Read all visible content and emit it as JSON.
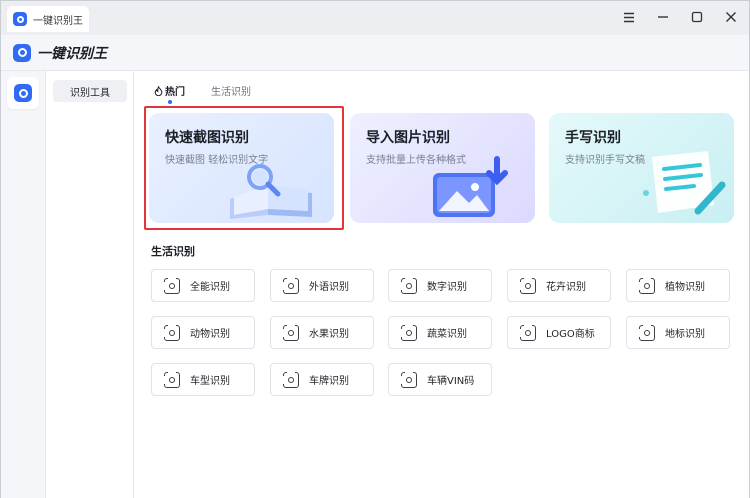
{
  "window": {
    "tab_title": "一键识别王",
    "buttons": [
      "menu-icon",
      "minimize-icon",
      "maximize-icon",
      "close-icon"
    ]
  },
  "header": {
    "app_name": "一键识别王"
  },
  "sidebar": {
    "items": [
      {
        "label": "识别工具",
        "active": true
      }
    ]
  },
  "main": {
    "tabs": [
      {
        "label": "热门",
        "icon": "flame-icon",
        "active": true
      },
      {
        "label": "生活识别",
        "active": false
      }
    ],
    "features": [
      {
        "title": "快速截图识别",
        "subtitle": "快速截图 轻松识别文字",
        "icon": "book-search-illustration",
        "selected": true
      },
      {
        "title": "导入图片识别",
        "subtitle": "支持批量上传各种格式",
        "icon": "image-import-illustration"
      },
      {
        "title": "手写识别",
        "subtitle": "支持识别手写文稿",
        "icon": "paper-pen-illustration"
      }
    ],
    "section_title": "生活识别",
    "tools": [
      {
        "label": "全能识别",
        "icon": "eye-scan-icon"
      },
      {
        "label": "外语识别",
        "icon": "abc-scan-icon"
      },
      {
        "label": "数字识别",
        "icon": "123-scan-icon"
      },
      {
        "label": "花卉识别",
        "icon": "flower-scan-icon"
      },
      {
        "label": "植物识别",
        "icon": "plant-scan-icon"
      },
      {
        "label": "动物识别",
        "icon": "animal-scan-icon"
      },
      {
        "label": "水果识别",
        "icon": "fruit-scan-icon"
      },
      {
        "label": "蔬菜识别",
        "icon": "vegetable-scan-icon"
      },
      {
        "label": "LOGO商标",
        "icon": "logo-scan-icon"
      },
      {
        "label": "地标识别",
        "icon": "landmark-scan-icon"
      },
      {
        "label": "车型识别",
        "icon": "car-scan-icon"
      },
      {
        "label": "车牌识别",
        "icon": "plate-scan-icon"
      },
      {
        "label": "车辆VIN码",
        "icon": "vin-scan-icon"
      }
    ]
  },
  "colors": {
    "accent": "#2f6bf5",
    "highlight": "#e0353a"
  }
}
